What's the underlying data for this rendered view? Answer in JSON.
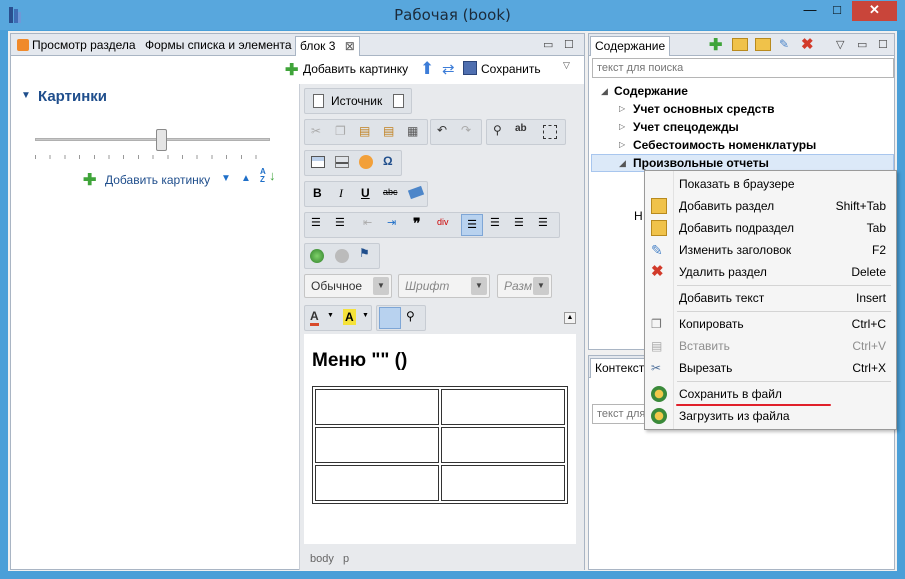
{
  "window": {
    "title": "Рабочая (book)",
    "minimize": "—",
    "maximize": "□",
    "close": "✕"
  },
  "left_tabs": [
    {
      "label": "Просмотр раздела"
    },
    {
      "label": "Формы списка и элемента"
    },
    {
      "label": "блок 3"
    }
  ],
  "left_toolbar": {
    "add_image": "Добавить картинку",
    "save": "Сохранить"
  },
  "pictures": {
    "header": "Картинки",
    "add_image": "Добавить картинку",
    "slider_level": 0.54
  },
  "editor": {
    "source_label": "Источник",
    "format_combo": "Обычное",
    "font_combo": "Шрифт",
    "size_combo": "Разм",
    "heading": "Меню \"\" ()",
    "status_path": "body   p"
  },
  "content_pane": {
    "tab_label": "Содержание",
    "search_placeholder": "текст для поиска",
    "root": "Содержание",
    "items": [
      {
        "label": "Учет основных средств"
      },
      {
        "label": "Учет спецодежды"
      },
      {
        "label": "Себестоимость номенклатуры"
      },
      {
        "label": "Произвольные отчеты"
      }
    ],
    "partial_letter": "Н"
  },
  "context_pane": {
    "tab_label": "Контекст",
    "search_placeholder": "текст для"
  },
  "context_menu": {
    "items": [
      {
        "label": "Показать в браузере",
        "shortcut": "",
        "icon": "none"
      },
      {
        "label": "Добавить раздел",
        "shortcut": "Shift+Tab",
        "icon": "add-section-icon"
      },
      {
        "label": "Добавить подраздел",
        "shortcut": "Tab",
        "icon": "add-subsection-icon"
      },
      {
        "label": "Изменить заголовок",
        "shortcut": "F2",
        "icon": "edit-title-icon"
      },
      {
        "label": "Удалить раздел",
        "shortcut": "Delete",
        "icon": "delete-icon"
      },
      {
        "label": "Добавить текст",
        "shortcut": "Insert",
        "icon": "none"
      },
      {
        "label": "Копировать",
        "shortcut": "Ctrl+C",
        "icon": "copy-icon"
      },
      {
        "label": "Вставить",
        "shortcut": "Ctrl+V",
        "icon": "paste-icon"
      },
      {
        "label": "Вырезать",
        "shortcut": "Ctrl+X",
        "icon": "cut-icon"
      },
      {
        "label": "Сохранить в файл",
        "shortcut": "",
        "icon": "save-file-icon"
      },
      {
        "label": "Загрузить из файла",
        "shortcut": "",
        "icon": "load-file-icon"
      }
    ]
  },
  "colors": {
    "accent": "#58a7dd",
    "highlight_underline": "#e0202a",
    "selection": "#dce9f8"
  }
}
